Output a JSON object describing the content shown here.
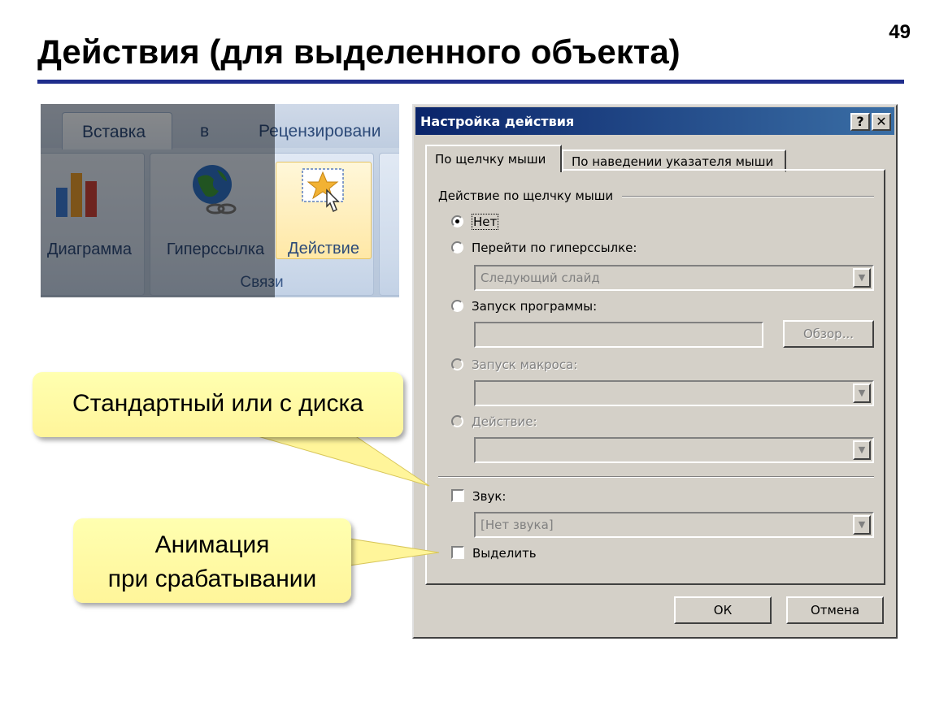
{
  "slide": {
    "title": "Действия (для выделенного объекта)",
    "page_number": "49"
  },
  "ribbon": {
    "tabs": [
      "Вставка",
      "в",
      "Рецензировани"
    ],
    "buttons": {
      "chart": "Диаграмма",
      "hyperlink": "Гиперссылка",
      "action": "Действие"
    },
    "group_label": "Связи"
  },
  "dialog": {
    "title": "Настройка действия",
    "help_button": "?",
    "close_button": "✕",
    "tabs": [
      "По щелчку мыши",
      "По наведении указателя мыши"
    ],
    "group_title": "Действие по щелчку мыши",
    "options": {
      "none": "Нет",
      "hyperlink": "Перейти по гиперссылке:",
      "run_program": "Запуск программы:",
      "run_macro": "Запуск макроса:",
      "action": "Действие:"
    },
    "hyperlink_value": "Следующий слайд",
    "browse_button": "Обзор...",
    "sound_label": "Звук:",
    "sound_value": "[Нет звука]",
    "highlight_label": "Выделить",
    "ok_button": "ОК",
    "cancel_button": "Отмена",
    "selected_option": "none"
  },
  "callouts": {
    "sound": "Стандартный или с диска",
    "highlight_line1": "Анимация",
    "highlight_line2": "при срабатывании"
  },
  "colors": {
    "title_rule": "#1f2d8c",
    "dialog_title": "#0a246a",
    "callout": "#fff59a"
  }
}
